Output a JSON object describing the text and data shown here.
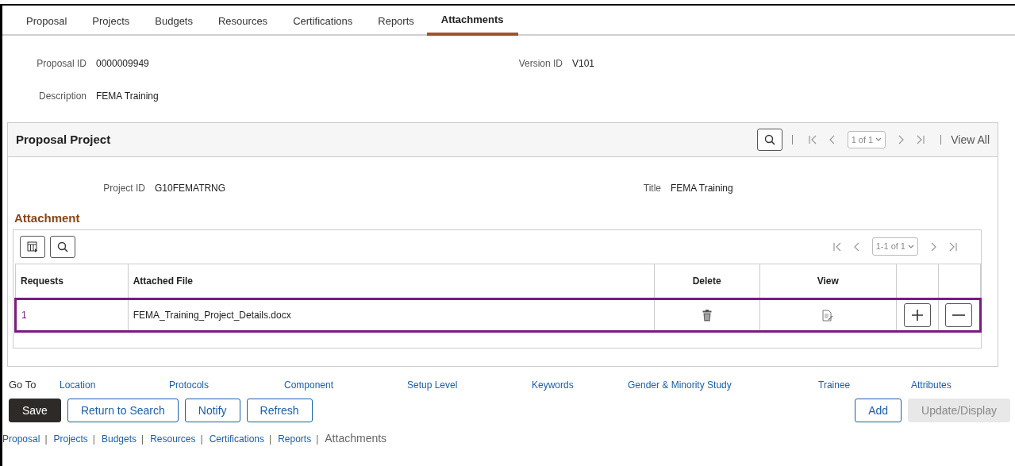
{
  "tabs": [
    {
      "label": "Proposal",
      "selected": false
    },
    {
      "label": "Projects",
      "selected": false
    },
    {
      "label": "Budgets",
      "selected": false
    },
    {
      "label": "Resources",
      "selected": false
    },
    {
      "label": "Certifications",
      "selected": false
    },
    {
      "label": "Reports",
      "selected": false
    },
    {
      "label": "Attachments",
      "selected": true
    }
  ],
  "header_fields": [
    {
      "label": "Proposal ID",
      "value": "0000009949"
    },
    {
      "label": "Version ID",
      "value": "V101"
    },
    {
      "label": "Description",
      "value": "FEMA Training"
    }
  ],
  "proposal_project": {
    "title": "Proposal Project",
    "pager": {
      "range": "1 of 1",
      "view_all": "View All"
    },
    "fields": [
      {
        "label": "Project ID",
        "value": "G10FEMATRNG"
      },
      {
        "label": "Title",
        "value": "FEMA Training"
      }
    ],
    "attachment": {
      "title": "Attachment",
      "pager": {
        "range": "1-1 of 1"
      },
      "columns": [
        "Requests",
        "Attached File",
        "Delete",
        "View"
      ],
      "rows": [
        {
          "request": "1",
          "file": "FEMA_Training_Project_Details.docx",
          "selected": true
        }
      ]
    }
  },
  "go_to": {
    "label": "Go To",
    "links": [
      "Location",
      "Protocols",
      "Component",
      "Setup Level",
      "Keywords",
      "Gender & Minority Study",
      "Trainee",
      "Attributes"
    ]
  },
  "buttons": {
    "left": [
      {
        "label": "Save",
        "kind": "primary"
      },
      {
        "label": "Return to Search",
        "kind": "secondary"
      },
      {
        "label": "Notify",
        "kind": "secondary"
      },
      {
        "label": "Refresh",
        "kind": "secondary"
      }
    ],
    "right": [
      {
        "label": "Add",
        "kind": "secondary"
      },
      {
        "label": "Update/Display",
        "kind": "disabled"
      }
    ]
  },
  "footer_separator": "|",
  "footer_links": [
    {
      "label": "Proposal",
      "selected": false
    },
    {
      "label": "Projects",
      "selected": false
    },
    {
      "label": "Budgets",
      "selected": false
    },
    {
      "label": "Resources",
      "selected": false
    },
    {
      "label": "Certifications",
      "selected": false
    },
    {
      "label": "Reports",
      "selected": false
    },
    {
      "label": "Attachments",
      "selected": true
    }
  ]
}
